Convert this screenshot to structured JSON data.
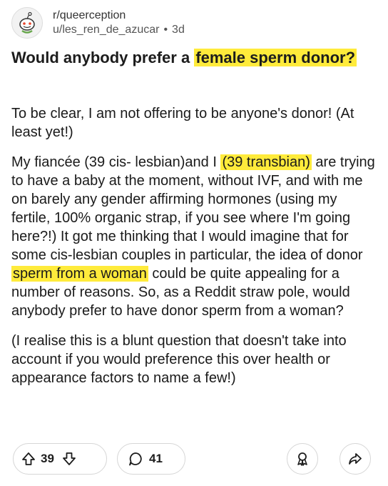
{
  "post": {
    "subreddit": "r/queerception",
    "author": "u/les_ren_de_azucar",
    "separator": "•",
    "age": "3d",
    "title_before": "Would anybody prefer a ",
    "title_highlight": "female sperm donor?",
    "para1": "To be clear, I am not offering to be anyone's donor! (At least yet!)",
    "para2_a": "My fiancée (39 cis- lesbian)and I ",
    "para2_hl1": "(39 transbian)",
    "para2_b": " are trying to have a baby at the moment, without IVF, and with me on barely any gender affirming hormones (using my fertile, 100% organic strap, if you see where I'm going here?!) It got me thinking that I would imagine that for some cis-lesbian couples in particular, the idea of donor ",
    "para2_hl2": "sperm from a woman",
    "para2_c": " could be quite appealing for a number of reasons. So, as a Reddit straw pole, would anybody prefer to have donor sperm from a woman?",
    "para3": "(I realise this is a blunt question that doesn't take into account if you would preference this over health or appearance factors to name a few!)"
  },
  "actions": {
    "upvote_count": "39",
    "comment_count": "41"
  },
  "icons": {
    "upvote": "upvote-arrow-icon",
    "downvote": "downvote-arrow-icon",
    "comment": "comment-bubble-icon",
    "award": "award-icon",
    "share": "share-arrow-icon",
    "subreddit_avatar": "snoo-avatar-icon"
  },
  "colors": {
    "highlight": "#ffeb3b",
    "text": "#1c1c1c",
    "border": "#d6d6d6"
  }
}
